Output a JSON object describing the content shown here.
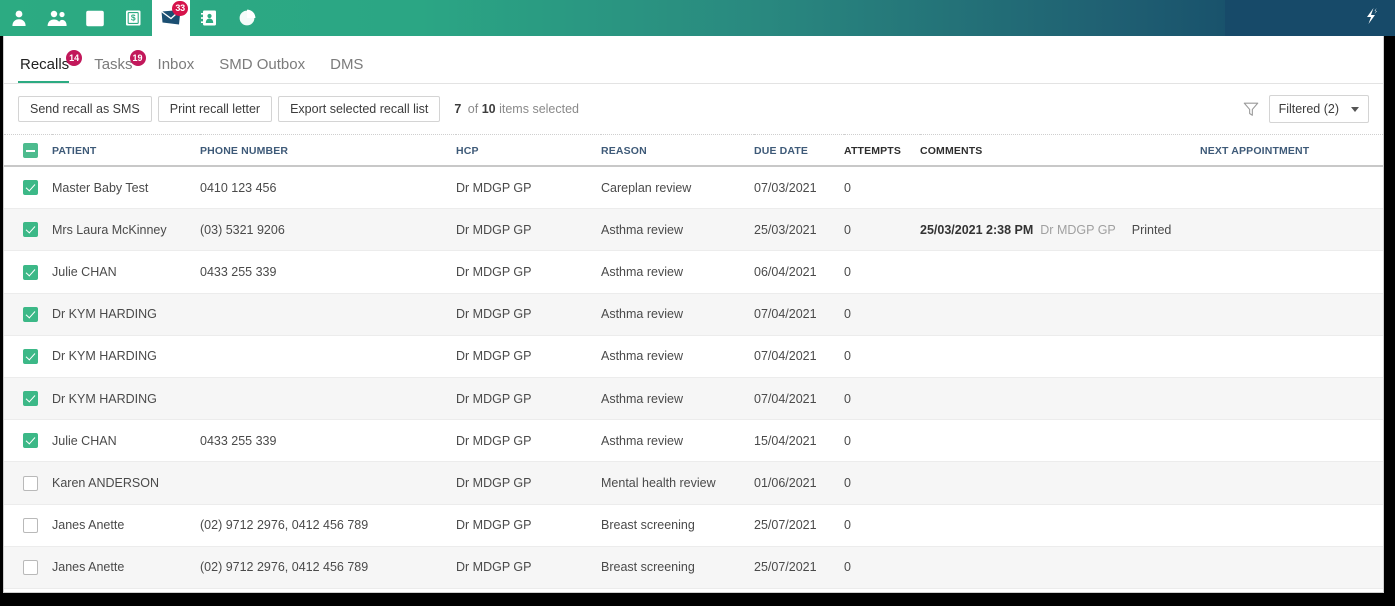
{
  "topbar": {
    "icons": [
      {
        "name": "patient-icon",
        "badge": null
      },
      {
        "name": "group-patients-icon",
        "badge": null
      },
      {
        "name": "calendar-icon",
        "badge": null
      },
      {
        "name": "cashbook-icon",
        "badge": null
      },
      {
        "name": "messages-envelope-icon",
        "badge": "33",
        "active": true
      },
      {
        "name": "address-book-icon",
        "badge": null
      },
      {
        "name": "reports-piechart-icon",
        "badge": null
      }
    ],
    "logo_name": "app-logo",
    "accent_green": "#2cab82",
    "accent_navy": "#174a69",
    "badge_color": "#d6134b"
  },
  "tabs": [
    {
      "label": "Recalls",
      "badge": "14",
      "active": true
    },
    {
      "label": "Tasks",
      "badge": "19",
      "active": false
    },
    {
      "label": "Inbox",
      "badge": null,
      "active": false
    },
    {
      "label": "SMD Outbox",
      "badge": null,
      "active": false
    },
    {
      "label": "DMS",
      "badge": null,
      "active": false
    }
  ],
  "toolbar": {
    "send_sms_label": "Send recall as SMS",
    "print_letter_label": "Print recall letter",
    "export_label": "Export selected recall list",
    "selected_count": "7",
    "of_word": "of",
    "total_count": "10",
    "items_selected_label": "items selected",
    "filter_icon_name": "funnel-filter-icon",
    "filter_dropdown_label": "Filtered (2)"
  },
  "table": {
    "columns": [
      {
        "key": "checkbox",
        "label": ""
      },
      {
        "key": "patient",
        "label": "PATIENT"
      },
      {
        "key": "phone",
        "label": "PHONE NUMBER"
      },
      {
        "key": "hcp",
        "label": "HCP"
      },
      {
        "key": "reason",
        "label": "REASON"
      },
      {
        "key": "due",
        "label": "DUE DATE"
      },
      {
        "key": "attempts",
        "label": "ATTEMPTS"
      },
      {
        "key": "comments",
        "label": "COMMENTS"
      },
      {
        "key": "next",
        "label": "NEXT APPOINTMENT"
      }
    ],
    "header_checkbox_state": "indeterminate",
    "rows": [
      {
        "checked": true,
        "patient": "Master Baby Test",
        "phone": "0410 123 456",
        "hcp": "Dr MDGP GP",
        "reason": "Careplan review",
        "due": "07/03/2021",
        "attempts": "0",
        "comment_date": "",
        "comment_by": "",
        "comment_status": "",
        "next": ""
      },
      {
        "checked": true,
        "patient": "Mrs Laura McKinney",
        "phone": "(03) 5321 9206",
        "hcp": "Dr MDGP GP",
        "reason": "Asthma review",
        "due": "25/03/2021",
        "attempts": "0",
        "comment_date": "25/03/2021 2:38 PM",
        "comment_by": "Dr MDGP GP",
        "comment_status": "Printed",
        "next": ""
      },
      {
        "checked": true,
        "patient": "Julie CHAN",
        "phone": "0433 255 339",
        "hcp": "Dr MDGP GP",
        "reason": "Asthma review",
        "due": "06/04/2021",
        "attempts": "0",
        "comment_date": "",
        "comment_by": "",
        "comment_status": "",
        "next": ""
      },
      {
        "checked": true,
        "patient": "Dr KYM HARDING",
        "phone": "",
        "hcp": "Dr MDGP GP",
        "reason": "Asthma review",
        "due": "07/04/2021",
        "attempts": "0",
        "comment_date": "",
        "comment_by": "",
        "comment_status": "",
        "next": ""
      },
      {
        "checked": true,
        "patient": "Dr KYM HARDING",
        "phone": "",
        "hcp": "Dr MDGP GP",
        "reason": "Asthma review",
        "due": "07/04/2021",
        "attempts": "0",
        "comment_date": "",
        "comment_by": "",
        "comment_status": "",
        "next": ""
      },
      {
        "checked": true,
        "patient": "Dr KYM HARDING",
        "phone": "",
        "hcp": "Dr MDGP GP",
        "reason": "Asthma review",
        "due": "07/04/2021",
        "attempts": "0",
        "comment_date": "",
        "comment_by": "",
        "comment_status": "",
        "next": ""
      },
      {
        "checked": true,
        "patient": "Julie CHAN",
        "phone": "0433 255 339",
        "hcp": "Dr MDGP GP",
        "reason": "Asthma review",
        "due": "15/04/2021",
        "attempts": "0",
        "comment_date": "",
        "comment_by": "",
        "comment_status": "",
        "next": ""
      },
      {
        "checked": false,
        "patient": "Karen ANDERSON",
        "phone": "",
        "hcp": "Dr MDGP GP",
        "reason": "Mental health review",
        "due": "01/06/2021",
        "attempts": "0",
        "comment_date": "",
        "comment_by": "",
        "comment_status": "",
        "next": ""
      },
      {
        "checked": false,
        "patient": "Janes Anette",
        "phone": "(02) 9712 2976, 0412 456 789",
        "hcp": "Dr MDGP GP",
        "reason": "Breast screening",
        "due": "25/07/2021",
        "attempts": "0",
        "comment_date": "",
        "comment_by": "",
        "comment_status": "",
        "next": ""
      },
      {
        "checked": false,
        "patient": "Janes Anette",
        "phone": "(02) 9712 2976, 0412 456 789",
        "hcp": "Dr MDGP GP",
        "reason": "Breast screening",
        "due": "25/07/2021",
        "attempts": "0",
        "comment_date": "",
        "comment_by": "",
        "comment_status": "",
        "next": ""
      }
    ]
  }
}
